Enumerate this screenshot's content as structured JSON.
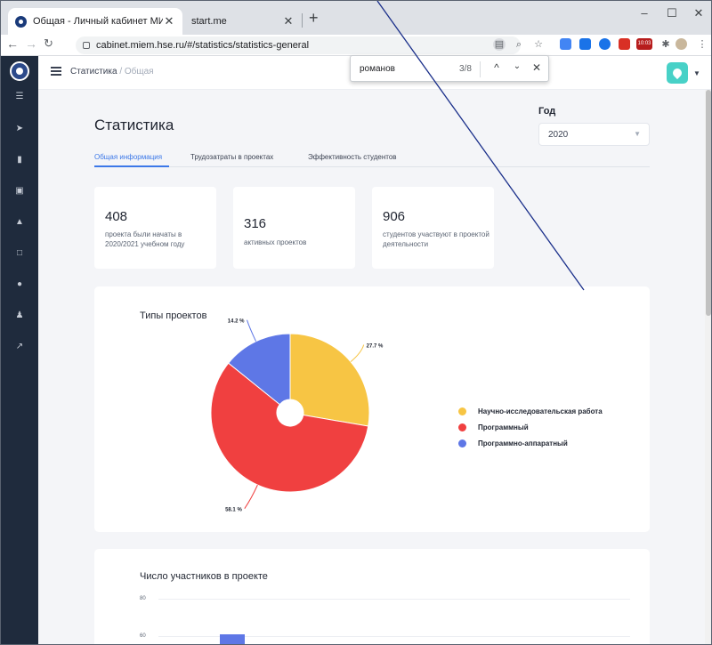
{
  "browser": {
    "active_tab_title": "Общая - Личный кабинет МИЭ",
    "inactive_tab_title": "start.me",
    "address": "cabinet.miem.hse.ru/#/statistics/statistics-general",
    "find_query": "романов",
    "find_count": "3/8",
    "clock_badge": "10:03",
    "extension_colors": [
      "#4285f4",
      "#d93025",
      "#1a73e8",
      "#0f9d58",
      "#e53935",
      "#5f6368"
    ]
  },
  "sidebar": {
    "icons": [
      "list-icon",
      "send-icon",
      "chart-icon",
      "folder-icon",
      "lock-icon",
      "book-icon",
      "chat-icon",
      "bell-icon",
      "external-link-icon"
    ]
  },
  "header": {
    "breadcrumb_root": "Статистика",
    "breadcrumb_sep": "/",
    "breadcrumb_current": "Общая"
  },
  "page": {
    "title": "Статистика",
    "year_label": "Год",
    "year_value": "2020",
    "tabs": [
      "Общая информация",
      "Трудозатраты в проектах",
      "Эффективность студентов"
    ]
  },
  "stats": [
    {
      "value": "408",
      "desc": "проекта были начаты в 2020/2021 учебном году"
    },
    {
      "value": "316",
      "desc": "активных проектов"
    },
    {
      "value": "906",
      "desc": "студентов участвуют в проектой деятельности"
    }
  ],
  "pie_card": {
    "title": "Типы проектов",
    "legend": [
      {
        "label": "Научно-исследовательская работа",
        "color": "#f7c544"
      },
      {
        "label": "Программный",
        "color": "#f04040"
      },
      {
        "label": "Программно-аппаратный",
        "color": "#5e77e6"
      }
    ]
  },
  "bar_card": {
    "title": "Число участников в проекте",
    "y_ticks": [
      "80",
      "60"
    ],
    "bar_color": "#5e77e6"
  },
  "chart_data": {
    "type": "pie",
    "donut": true,
    "categories": [
      "Научно-исследовательская работа",
      "Программный",
      "Программно-аппаратный"
    ],
    "values": [
      27.7,
      58.1,
      14.2
    ],
    "labels": [
      "27.7 %",
      "58.1 %",
      "14.2 %"
    ],
    "colors": [
      "#f7c544",
      "#f04040",
      "#5e77e6"
    ],
    "title": "Типы проектов",
    "legend": "right"
  }
}
